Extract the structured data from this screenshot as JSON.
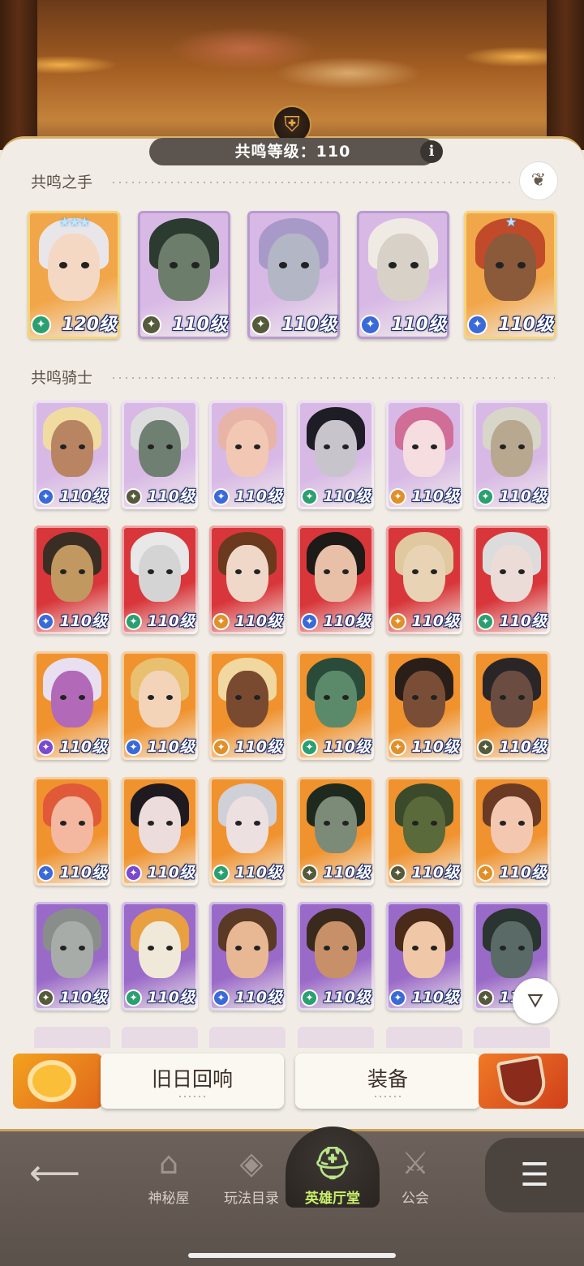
{
  "header": {
    "resonance_level": "共鸣等级：110",
    "info_label": "i",
    "crest_icon": "helmet-crest-icon"
  },
  "sections": {
    "hands_title": "共鸣之手",
    "knights_title": "共鸣骑士"
  },
  "hands": [
    {
      "level": "120级",
      "faction": "wilder",
      "stars": "★★★",
      "bg": "#f2a64a",
      "frame": "#f5d47a",
      "hair": "#e9e6ea",
      "skin": "#f4d8c4"
    },
    {
      "level": "110级",
      "faction": "graveborn",
      "stars": "",
      "bg": "#d8b9e6",
      "frame": "#b99ad0",
      "hair": "#2c3b2f",
      "skin": "#6c7d6b"
    },
    {
      "level": "110级",
      "faction": "graveborn",
      "stars": "",
      "bg": "#d8b9e6",
      "frame": "#b99ad0",
      "hair": "#a79ac8",
      "skin": "#b3b6c4"
    },
    {
      "level": "110级",
      "faction": "lightbearer",
      "stars": "",
      "bg": "#d8b9e6",
      "frame": "#b99ad0",
      "hair": "#efeae4",
      "skin": "#d8d1c8"
    },
    {
      "level": "110级",
      "faction": "lightbearer",
      "stars": "★",
      "bg": "#f2a64a",
      "frame": "#f5d47a",
      "hair": "#c04a2a",
      "skin": "#8a5a3a"
    }
  ],
  "knights": [
    {
      "level": "110级",
      "faction": "lightbearer",
      "bg": "#d8b9e6",
      "hair": "#f0dca0",
      "skin": "#b88462"
    },
    {
      "level": "110级",
      "faction": "graveborn",
      "bg": "#d8b9e6",
      "hair": "#dddddd",
      "skin": "#6f7f72"
    },
    {
      "level": "110级",
      "faction": "lightbearer",
      "bg": "#d8b9e6",
      "hair": "#e8b4a8",
      "skin": "#f2c8b4"
    },
    {
      "level": "110级",
      "faction": "wilder",
      "bg": "#d8b9e6",
      "hair": "#1e1c24",
      "skin": "#c8c4cc"
    },
    {
      "level": "110级",
      "faction": "mauler",
      "bg": "#d8b9e6",
      "hair": "#d06e98",
      "skin": "#f5dde0"
    },
    {
      "level": "110级",
      "faction": "wilder",
      "bg": "#d8b9e6",
      "hair": "#d8d6c8",
      "skin": "#b8a890"
    },
    {
      "level": "110级",
      "faction": "lightbearer",
      "bg": "#d8363a",
      "hair": "#3a2e24",
      "skin": "#c09860"
    },
    {
      "level": "110级",
      "faction": "wilder",
      "bg": "#d8363a",
      "hair": "#e8e8e8",
      "skin": "#d4d4d4"
    },
    {
      "level": "110级",
      "faction": "mauler",
      "bg": "#d8363a",
      "hair": "#6b3a1e",
      "skin": "#f0d8c8"
    },
    {
      "level": "110级",
      "faction": "lightbearer",
      "bg": "#d8363a",
      "hair": "#1e1a18",
      "skin": "#e8c0a8"
    },
    {
      "level": "110级",
      "faction": "mauler",
      "bg": "#d8363a",
      "hair": "#e0c8a0",
      "skin": "#e8d4b4"
    },
    {
      "level": "110级",
      "faction": "wilder",
      "bg": "#d8363a",
      "hair": "#dcdcdc",
      "skin": "#ecdcd8"
    },
    {
      "level": "110级",
      "faction": "celestial",
      "bg": "#f0922e",
      "hair": "#e8e0f0",
      "skin": "#b26ab8"
    },
    {
      "level": "110级",
      "faction": "lightbearer",
      "bg": "#f0922e",
      "hair": "#e8c070",
      "skin": "#f4d4b8"
    },
    {
      "level": "110级",
      "faction": "mauler",
      "bg": "#f0922e",
      "hair": "#f0d8a0",
      "skin": "#7a4a30"
    },
    {
      "level": "110级",
      "faction": "wilder",
      "bg": "#f0922e",
      "hair": "#2a4a3a",
      "skin": "#5a8a6a"
    },
    {
      "level": "110级",
      "faction": "mauler",
      "bg": "#f0922e",
      "hair": "#2a1e18",
      "skin": "#7a4e36"
    },
    {
      "level": "110级",
      "faction": "graveborn",
      "bg": "#f0922e",
      "hair": "#2a2628",
      "skin": "#6a4c40"
    },
    {
      "level": "110级",
      "faction": "lightbearer",
      "bg": "#f0922e",
      "hair": "#e05a3a",
      "skin": "#f4b8a0"
    },
    {
      "level": "110级",
      "faction": "celestial",
      "bg": "#f0922e",
      "hair": "#1e1a20",
      "skin": "#ecdcdc"
    },
    {
      "level": "110级",
      "faction": "wilder",
      "bg": "#f0922e",
      "hair": "#d0d0d8",
      "skin": "#ece0e0"
    },
    {
      "level": "110级",
      "faction": "graveborn",
      "bg": "#f0922e",
      "hair": "#1e2a1e",
      "skin": "#7c8a78"
    },
    {
      "level": "110级",
      "faction": "graveborn",
      "bg": "#f0922e",
      "hair": "#3a4a2a",
      "skin": "#5a6a3a"
    },
    {
      "level": "110级",
      "faction": "mauler",
      "bg": "#f0922e",
      "hair": "#6a3a24",
      "skin": "#f4c8b0"
    },
    {
      "level": "110级",
      "faction": "graveborn",
      "bg": "#9a6ac8",
      "hair": "#8a8e8a",
      "skin": "#a8aca8"
    },
    {
      "level": "110级",
      "faction": "wilder",
      "bg": "#9a6ac8",
      "hair": "#e8a040",
      "skin": "#f0e8d8"
    },
    {
      "level": "110级",
      "faction": "lightbearer",
      "bg": "#9a6ac8",
      "hair": "#5a3a24",
      "skin": "#e8b894"
    },
    {
      "level": "110级",
      "faction": "wilder",
      "bg": "#9a6ac8",
      "hair": "#3a2a1e",
      "skin": "#c89068"
    },
    {
      "level": "110级",
      "faction": "lightbearer",
      "bg": "#9a6ac8",
      "hair": "#4a2a18",
      "skin": "#f0c8a8"
    },
    {
      "level": "110级",
      "faction": "graveborn",
      "bg": "#9a6ac8",
      "hair": "#2a3430",
      "skin": "#5a6a66"
    }
  ],
  "faction_colors": {
    "lightbearer": "#3a6ad8",
    "mauler": "#e0902a",
    "wilder": "#2aa070",
    "graveborn": "#555a3a",
    "celestial": "#7a4ad0"
  },
  "actions": {
    "echoes_label": "旧日回响",
    "equipment_label": "装备",
    "filter_icon": "filter-icon"
  },
  "nav": {
    "back_icon": "back-arrow-icon",
    "items": [
      {
        "label": "神秘屋",
        "icon": "mystic-house-icon"
      },
      {
        "label": "玩法目录",
        "icon": "play-catalog-icon"
      },
      {
        "label": "英雄厅堂",
        "icon": "hero-hall-icon"
      },
      {
        "label": "公会",
        "icon": "guild-icon"
      }
    ],
    "menu_icon": "menu-icon"
  }
}
